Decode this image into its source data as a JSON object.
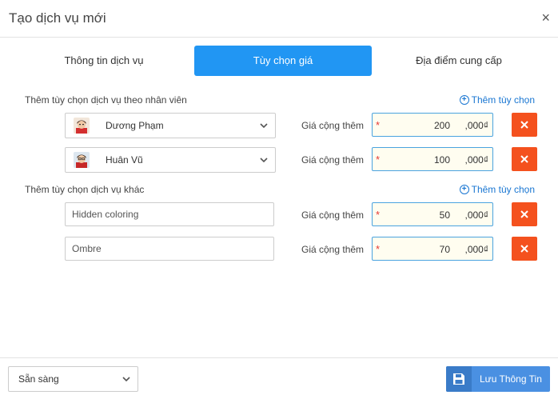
{
  "dialog": {
    "title": "Tạo dịch vụ mới",
    "close_label": "×"
  },
  "tabs": [
    {
      "label": "Thông tin dịch vụ",
      "active": false
    },
    {
      "label": "Tùy chọn giá",
      "active": true
    },
    {
      "label": "Địa điểm cung cấp",
      "active": false
    }
  ],
  "staff_section": {
    "label": "Thêm tùy chọn dịch vụ theo nhân viên",
    "add_label": "Thêm tùy chọn",
    "rows": [
      {
        "name": "Dương Phạm",
        "price_label": "Giá cộng thêm",
        "required_mark": "*",
        "price": "200",
        "unit": ",000₫"
      },
      {
        "name": "Huân Vũ",
        "price_label": "Giá cộng thêm",
        "required_mark": "*",
        "price": "100",
        "unit": ",000₫"
      }
    ]
  },
  "other_section": {
    "label": "Thêm tùy chọn dịch vụ khác",
    "add_label": "Thêm tùy chọn",
    "rows": [
      {
        "name": "Hidden coloring",
        "price_label": "Giá cộng thêm",
        "required_mark": "*",
        "price": "50",
        "unit": ",000₫"
      },
      {
        "name": "Ombre",
        "price_label": "Giá cộng thêm",
        "required_mark": "*",
        "price": "70",
        "unit": ",000₫"
      }
    ]
  },
  "footer": {
    "status": "Sẵn sàng",
    "save_label": "Lưu Thông Tin"
  },
  "colors": {
    "accent": "#2196f3",
    "delete": "#f4511e",
    "save": "#4a90e2",
    "link": "#1976d2"
  }
}
